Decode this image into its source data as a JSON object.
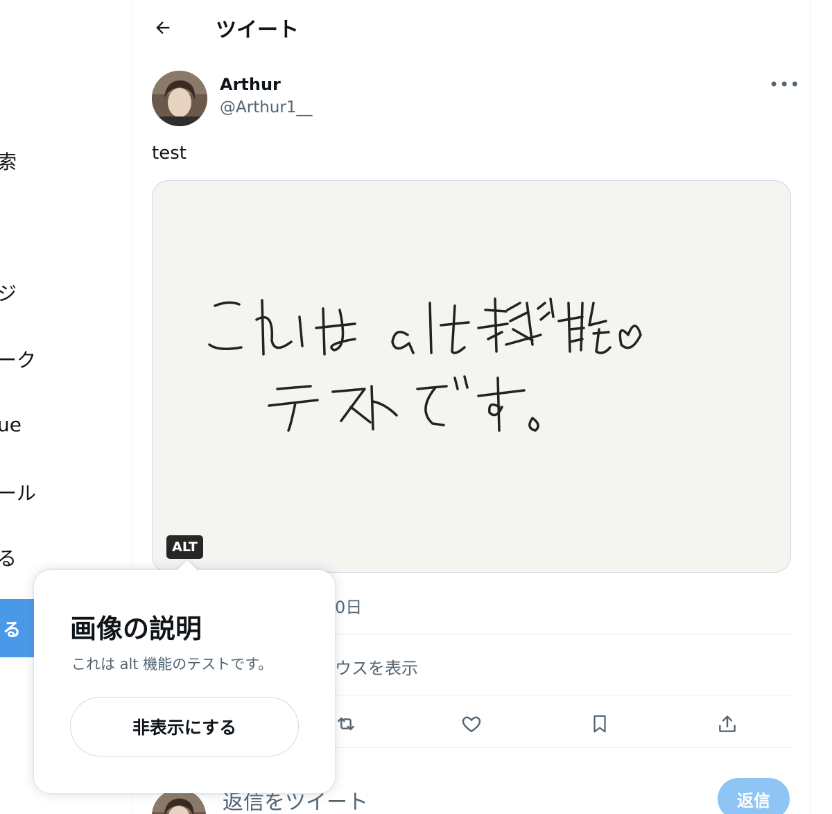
{
  "sidebar": {
    "fragments": [
      "索",
      "ジ",
      "ーク",
      "ue",
      "ール",
      "る"
    ],
    "tweet_button_label": "る"
  },
  "header": {
    "title": "ツイート"
  },
  "tweet": {
    "author_name": "Arthur",
    "author_handle": "@Arthur1__",
    "text": "test",
    "media_alt_badge": "ALT",
    "media_handwriting_line1": "これは alt 機能の",
    "media_handwriting_line2": "テストです。",
    "meta_fragment": "0日",
    "quote_fragment": "ウスを表示"
  },
  "actions": [
    "reply-icon",
    "retweet-icon",
    "like-icon",
    "bookmark-icon",
    "share-icon"
  ],
  "reply": {
    "placeholder": "返信をツイート",
    "button_label": "返信"
  },
  "alt_popup": {
    "title": "画像の説明",
    "description": "これは alt 機能のテストです。",
    "hide_button_label": "非表示にする"
  },
  "colors": {
    "accent": "#1d9bf0",
    "reply_button_disabled": "#8ec5f4",
    "sidebar_button": "#4a99e9"
  }
}
